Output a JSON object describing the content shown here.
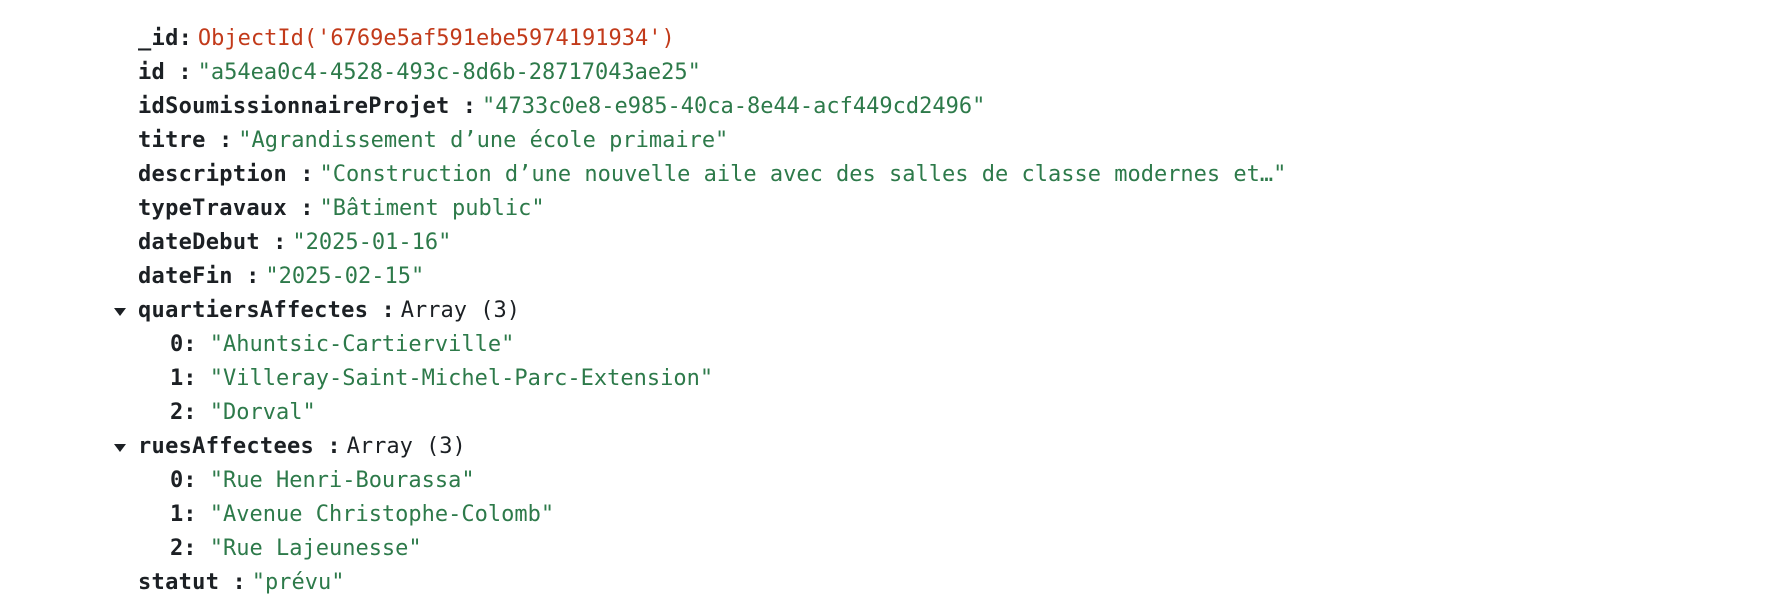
{
  "document": {
    "_id": {
      "key": "_id",
      "value": "ObjectId('6769e5af591ebe5974191934')"
    },
    "id": {
      "key": "id",
      "value": "\"a54ea0c4-4528-493c-8d6b-28717043ae25\""
    },
    "idSoumissionnaireProjet": {
      "key": "idSoumissionnaireProjet",
      "value": "\"4733c0e8-e985-40ca-8e44-acf449cd2496\""
    },
    "titre": {
      "key": "titre",
      "value": "\"Agrandissement d’une école primaire\""
    },
    "description": {
      "key": "description",
      "value": "\"Construction d’une nouvelle aile avec des salles de classe modernes et…\""
    },
    "typeTravaux": {
      "key": "typeTravaux",
      "value": "\"Bâtiment public\""
    },
    "dateDebut": {
      "key": "dateDebut",
      "value": "\"2025-01-16\""
    },
    "dateFin": {
      "key": "dateFin",
      "value": "\"2025-02-15\""
    },
    "quartiersAffectes": {
      "key": "quartiersAffectes",
      "type": "Array (3)",
      "items": [
        {
          "index": "0:",
          "value": "\"Ahuntsic-Cartierville\""
        },
        {
          "index": "1:",
          "value": "\"Villeray-Saint-Michel-Parc-Extension\""
        },
        {
          "index": "2:",
          "value": "\"Dorval\""
        }
      ]
    },
    "ruesAffectees": {
      "key": "ruesAffectees",
      "type": "Array (3)",
      "items": [
        {
          "index": "0:",
          "value": "\"Rue Henri-Bourassa\""
        },
        {
          "index": "1:",
          "value": "\"Avenue Christophe-Colomb\""
        },
        {
          "index": "2:",
          "value": "\"Rue Lajeunesse\""
        }
      ]
    },
    "statut": {
      "key": "statut",
      "value": "\"prévu\""
    }
  },
  "colors": {
    "key": "#1c2024",
    "string": "#2d7a4a",
    "objectId": "#c23a1a"
  }
}
